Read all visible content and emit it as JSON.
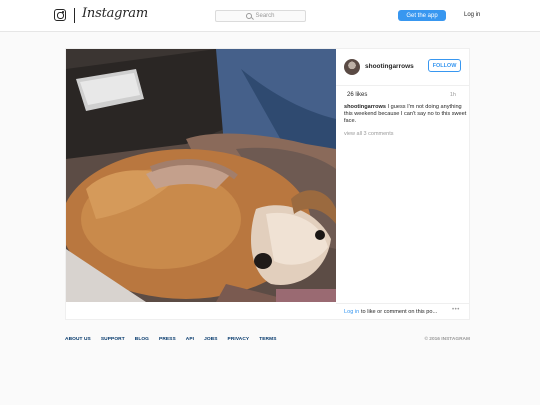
{
  "header": {
    "brand": "Instagram",
    "search_placeholder": "Search",
    "get_app": "Get the app",
    "login": "Log in"
  },
  "post": {
    "username": "shootingarrows",
    "follow": "FOLLOW",
    "likes": "26 likes",
    "time": "1h",
    "caption_user": "shootingarrows",
    "caption_text": " I guess I'm not doing anything this weekend because I can't say no to this sweet face.",
    "view_comments": "view all 3 comments",
    "comment_login": "Log in",
    "comment_prompt": " to like or comment on this po...",
    "more": "•••"
  },
  "footer": {
    "links": [
      "ABOUT US",
      "SUPPORT",
      "BLOG",
      "PRESS",
      "API",
      "JOBS",
      "PRIVACY",
      "TERMS"
    ],
    "copyright": "© 2016 INSTAGRAM"
  }
}
